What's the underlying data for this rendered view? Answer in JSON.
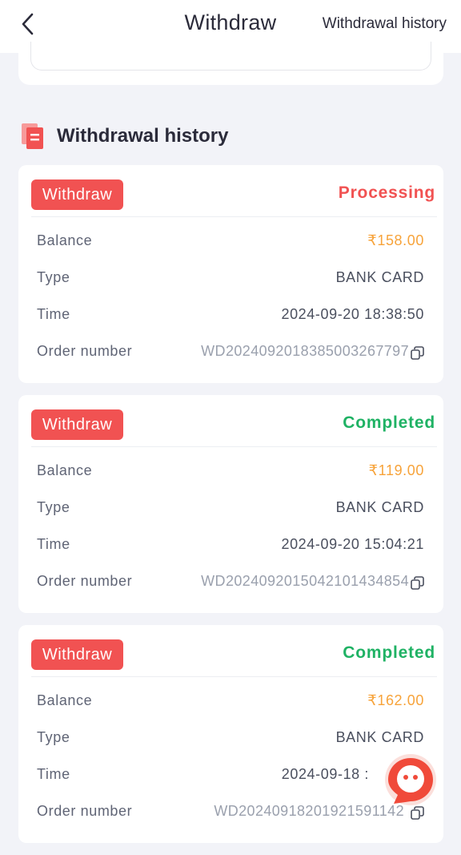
{
  "header": {
    "title": "Withdraw",
    "history_link": "Withdrawal history"
  },
  "section": {
    "title": "Withdrawal history"
  },
  "labels": {
    "balance": "Balance",
    "type": "Type",
    "time": "Time",
    "order": "Order number"
  },
  "records": [
    {
      "badge": "Withdraw",
      "status": "Processing",
      "balance": "₹158.00",
      "type": "BANK CARD",
      "time": "2024-09-20 18:38:50",
      "order": "WD2024092018385003267797"
    },
    {
      "badge": "Withdraw",
      "status": "Completed",
      "balance": "₹119.00",
      "type": "BANK CARD",
      "time": "2024-09-20 15:04:21",
      "order": "WD2024092015042101434854"
    },
    {
      "badge": "Withdraw",
      "status": "Completed",
      "balance": "₹162.00",
      "type": "BANK CARD",
      "time": "2024-09-18 :",
      "order": "WD20240918201921591142"
    }
  ],
  "icons": {
    "back": "chevron-left-icon",
    "section": "document-icon",
    "copy": "copy-icon",
    "chat": "chat-bubble-icon"
  },
  "colors": {
    "badge": "#f15252",
    "processing": "#f15252",
    "completed": "#1fb264",
    "amount": "#f7a33a"
  }
}
